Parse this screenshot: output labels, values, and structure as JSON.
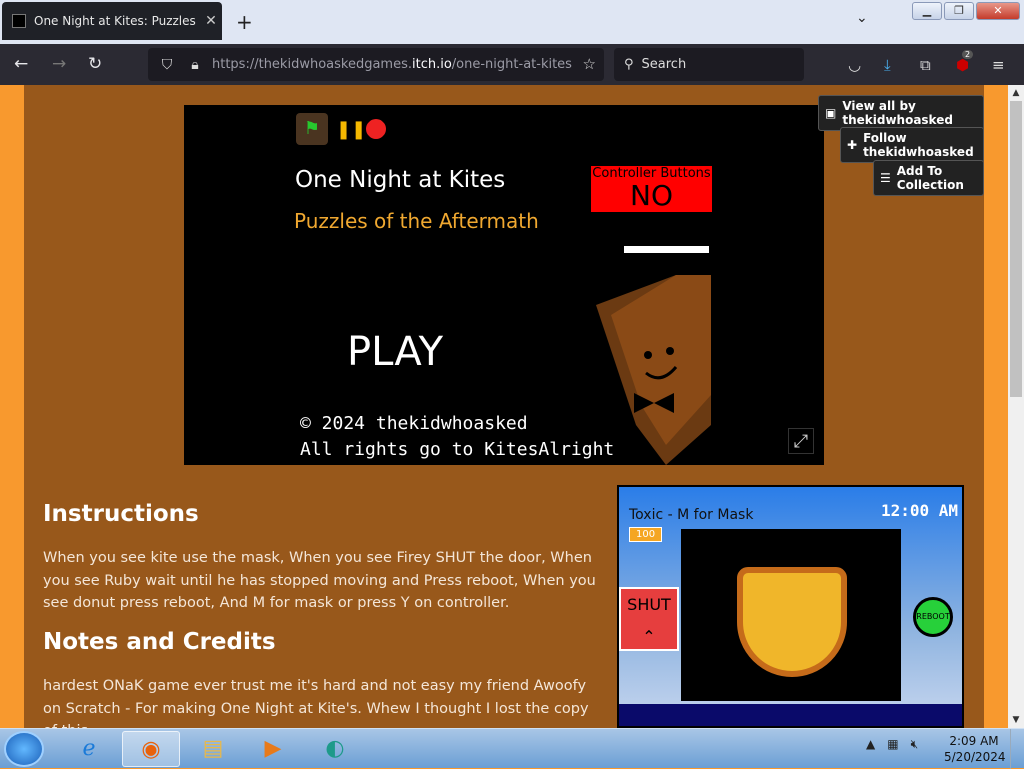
{
  "browser": {
    "tab_title": "One Night at Kites: Puzzles of th",
    "url_prefix": "https://thekidwhoaskedgames.",
    "url_domain": "itch.io",
    "url_path": "/one-night-at-kites-pu",
    "search_placeholder": "Search",
    "extension_badge": "2"
  },
  "sidebar_actions": {
    "view_all": "View all by thekidwhoasked",
    "follow": "Follow thekidwhoasked",
    "add_collection": "Add To Collection"
  },
  "game": {
    "title": "One Night at Kites",
    "subtitle": "Puzzles of the Aftermath",
    "controller_label": "Controller Buttons",
    "controller_value": "NO",
    "play": "PLAY",
    "copyright": "© 2024 thekidwhoasked",
    "rights": "All rights go to KitesAlright"
  },
  "instructions": {
    "heading": "Instructions",
    "text": "When you see kite use the mask, When you see Firey SHUT the door, When you see Ruby wait until he has stopped moving and Press reboot, When you see donut press reboot, And M for mask or press Y on controller."
  },
  "notes": {
    "heading": "Notes and Credits",
    "text": "hardest ONaK game ever trust me it's hard and not easy my friend Awoofy on Scratch  - For making One Night at Kite's. Whew I thought I lost the copy of this"
  },
  "screenshot": {
    "camera_label": "Toxic - M for Mask",
    "time": "12:00 AM",
    "hp": "100",
    "shut": "SHUT",
    "reboot": "REBOOT"
  },
  "taskbar": {
    "time": "2:09 AM",
    "date": "5/20/2024"
  }
}
